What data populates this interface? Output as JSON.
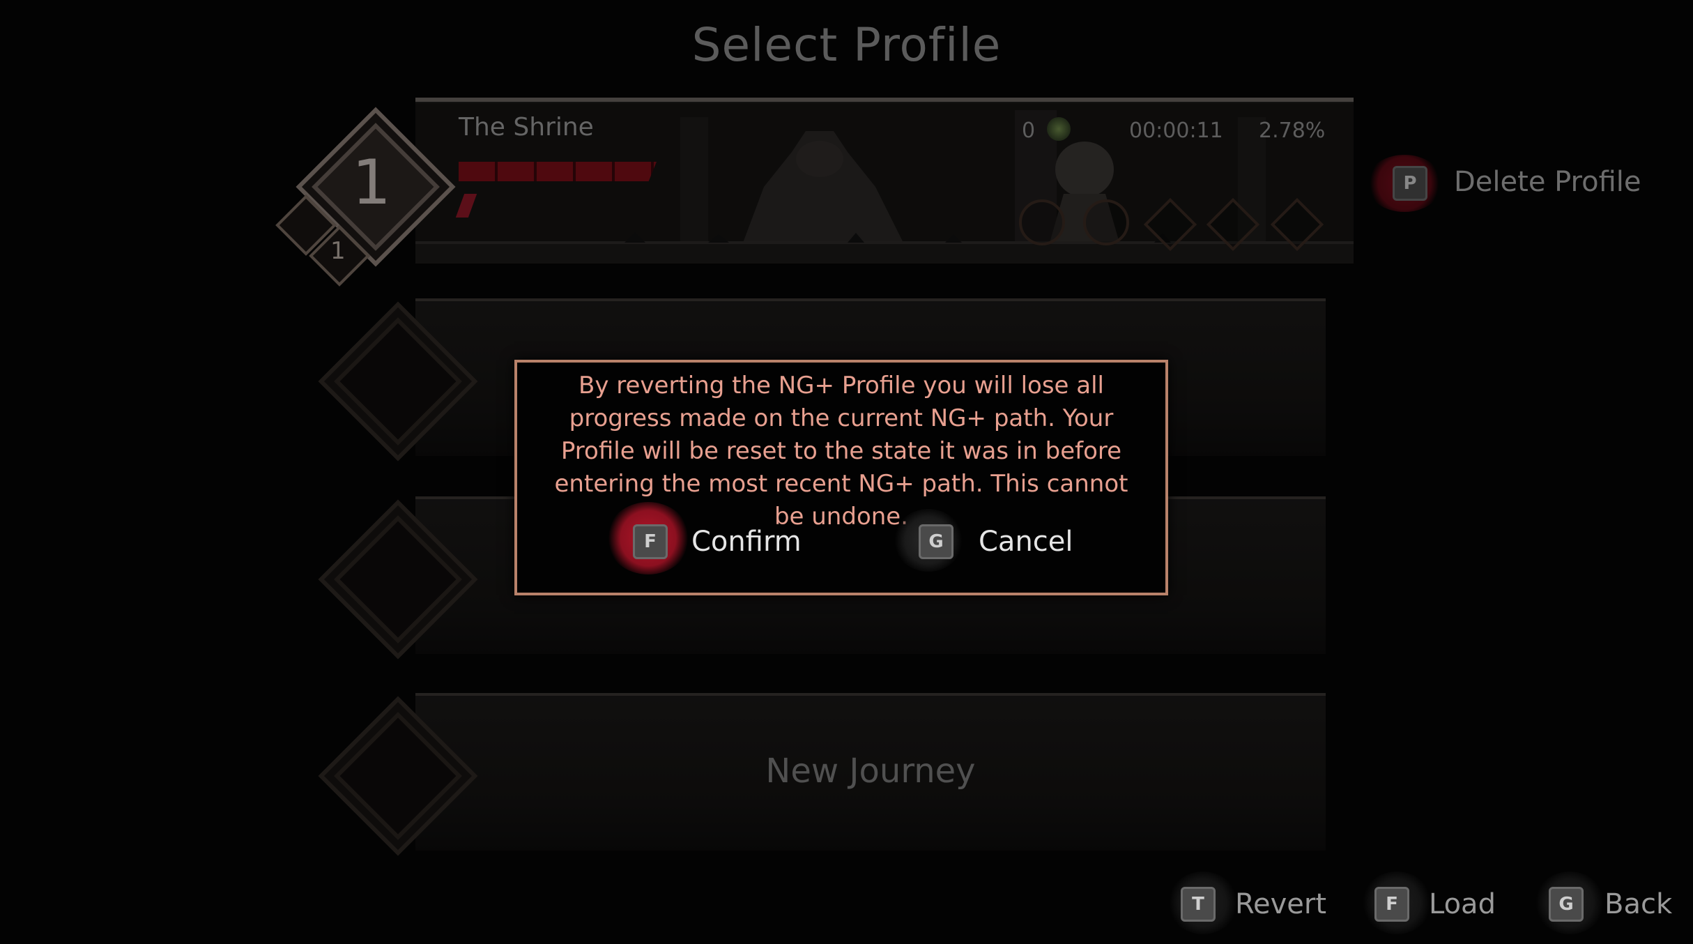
{
  "page": {
    "title": "Select Profile"
  },
  "profiles": [
    {
      "slot_number": "1",
      "ng_level": "1",
      "name": "The Shrine",
      "currency": "0",
      "playtime": "00:00:11",
      "completion": "2.78%"
    }
  ],
  "empty_slot_label": "New Journey",
  "side_action": {
    "key": "P",
    "label": "Delete Profile"
  },
  "dialog": {
    "message": "By reverting the NG+ Profile you will lose all progress made on the current NG+ path. Your Profile will be reset to the state it was in before entering the most recent NG+ path. This cannot be undone.",
    "confirm": {
      "key": "F",
      "label": "Confirm"
    },
    "cancel": {
      "key": "G",
      "label": "Cancel"
    }
  },
  "footer_prompts": [
    {
      "key": "T",
      "label": "Revert"
    },
    {
      "key": "F",
      "label": "Load"
    },
    {
      "key": "G",
      "label": "Back"
    }
  ],
  "colors": {
    "dialog_border": "#b9826a",
    "dialog_text": "#e8a090",
    "blood_red": "#8c1020",
    "health_red": "#7a0f18"
  },
  "icons": [
    "diamond-emblem-icon",
    "ng-plus-icon",
    "currency-orb-icon",
    "key-glyph-icon",
    "blood-splat-icon"
  ]
}
